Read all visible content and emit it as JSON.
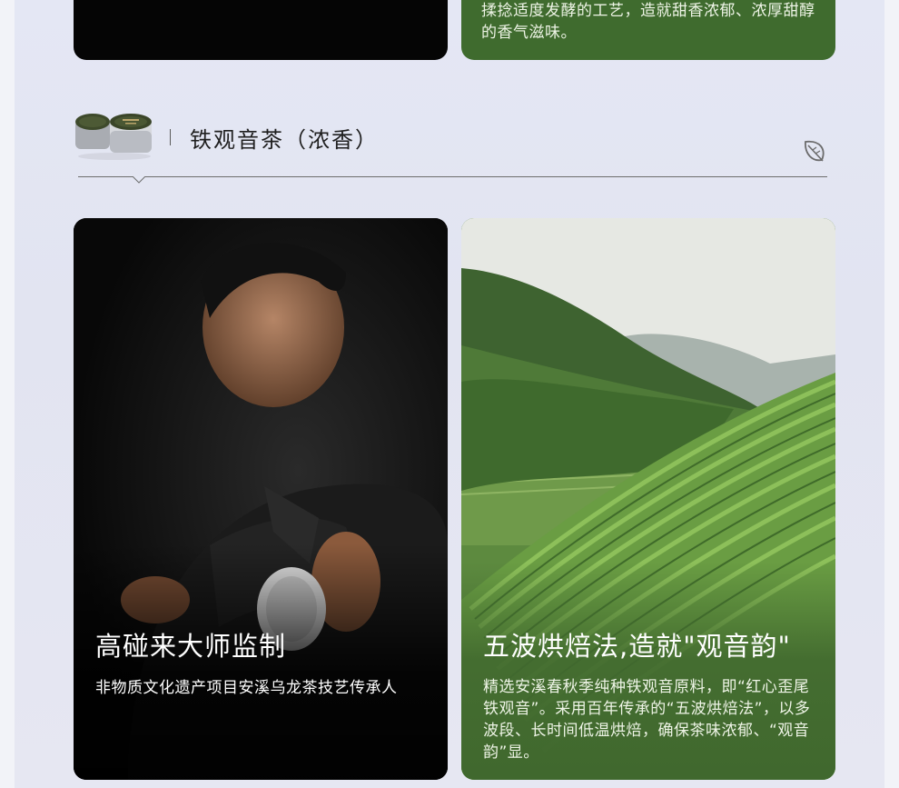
{
  "top_cards": {
    "right_desc": "揉捻适度发酵的工艺，造就甜香浓郁、浓厚甜醇的香气滋味。"
  },
  "section": {
    "title": "铁观音茶（浓香）",
    "product_icon": "tea-cans-icon",
    "decor_icon": "leaf-icon"
  },
  "cards": [
    {
      "title": "高碰来大师监制",
      "subtitle": "非物质文化遗产项目安溪乌龙茶技艺传承人",
      "image": "tea-master-photo"
    },
    {
      "title": "五波烘焙法,造就\"观音韵\"",
      "subtitle": "精选安溪春秋季纯种铁观音原料，即“红心歪尾铁观音”。采用百年传承的“五波烘焙法”，以多波段、长时间低温烘焙，确保茶味浓郁、“观音韵”显。",
      "image": "tea-plantation-photo"
    }
  ],
  "colors": {
    "green": "#40682e",
    "black": "#0b0b0b",
    "background": "#e4e7f4"
  }
}
